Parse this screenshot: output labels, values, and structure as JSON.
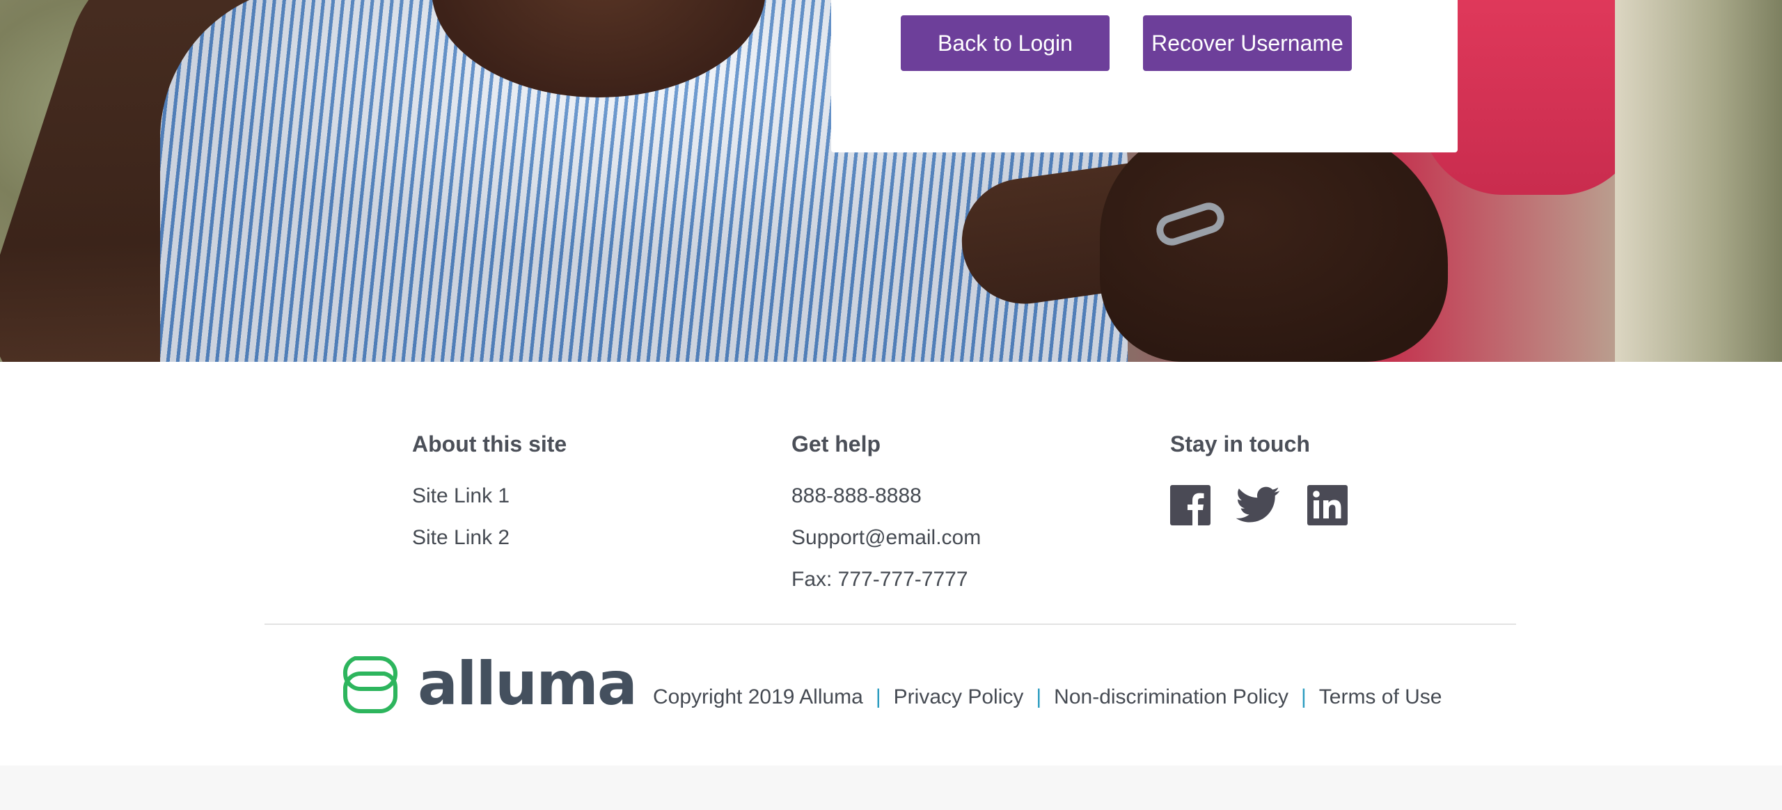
{
  "card": {
    "back_button": "Back to Login",
    "recover_button": "Recover Username",
    "button_color": "#6d3f9a"
  },
  "footer": {
    "about": {
      "title": "About this site",
      "links": [
        "Site Link 1",
        "Site Link 2"
      ]
    },
    "help": {
      "title": "Get help",
      "phone": "888-888-8888",
      "email": "Support@email.com",
      "fax": "Fax: 777-777-7777"
    },
    "social": {
      "title": "Stay in touch",
      "icons": [
        "facebook-icon",
        "twitter-icon",
        "linkedin-icon"
      ]
    },
    "brand": {
      "name": "alluma",
      "mark_color": "#2db55d",
      "text_color": "#44505e"
    },
    "legal": {
      "copyright": "Copyright 2019 Alluma",
      "privacy": "Privacy Policy",
      "nondiscrimination": "Non-discrimination Policy",
      "terms": "Terms of Use",
      "separator": "|",
      "separator_color": "#2a9bbf"
    }
  }
}
